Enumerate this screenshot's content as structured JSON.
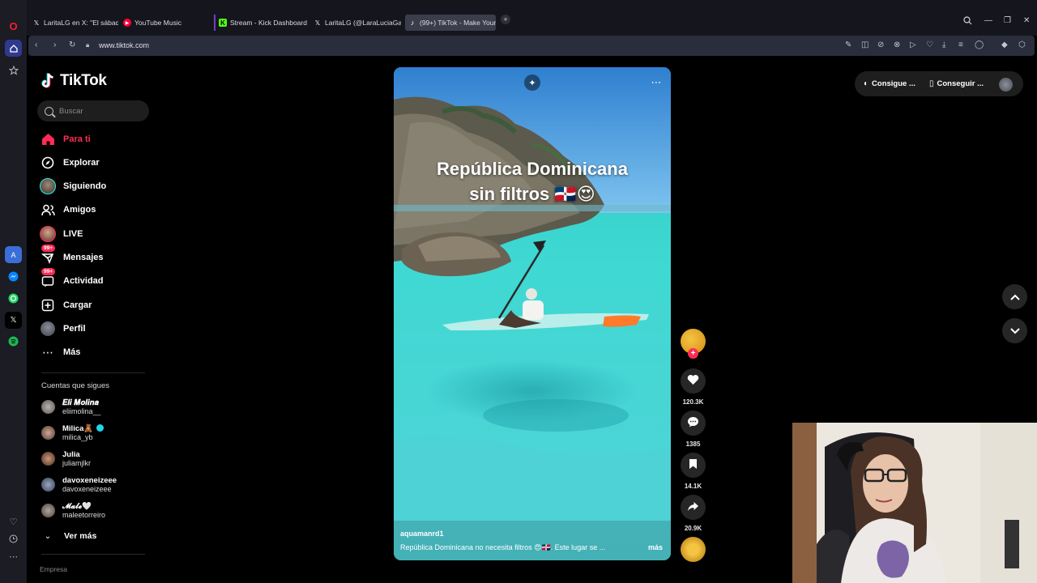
{
  "browser": {
    "tabs": [
      {
        "label": "LaritaLG en X: \"El sábado ·",
        "icon": "x-icon"
      },
      {
        "label": "YouTube Music",
        "icon": "youtube-music-icon"
      },
      {
        "label": "Stream - Kick Dashboard",
        "icon": "kick-icon"
      },
      {
        "label": "LaritaLG (@LaraLuciaGarc·",
        "icon": "x-icon"
      },
      {
        "label": "(99+) TikTok - Make Your ·",
        "icon": "tiktok-icon",
        "active": true
      }
    ],
    "url": "www.tiktok.com"
  },
  "sidebar": {
    "logo_text": "TikTok",
    "search_placeholder": "Buscar",
    "nav": [
      {
        "label": "Para ti",
        "icon": "home-icon",
        "active": true
      },
      {
        "label": "Explorar",
        "icon": "compass-icon"
      },
      {
        "label": "Siguiendo",
        "icon": "following-avatar-icon"
      },
      {
        "label": "Amigos",
        "icon": "friends-icon"
      },
      {
        "label": "LIVE",
        "icon": "live-avatar-icon"
      },
      {
        "label": "Mensajes",
        "icon": "messages-icon",
        "badge": "99+"
      },
      {
        "label": "Actividad",
        "icon": "activity-icon",
        "badge": "99+"
      },
      {
        "label": "Cargar",
        "icon": "upload-icon"
      },
      {
        "label": "Perfil",
        "icon": "profile-avatar-icon"
      },
      {
        "label": "Más",
        "icon": "more-icon"
      }
    ],
    "following_title": "Cuentas que sigues",
    "following": [
      {
        "display": "𝑬𝒍𝒊 𝑴𝒐𝒍𝒊𝒏𝒂",
        "handle": "eliimolina__"
      },
      {
        "display": "Milica🧸",
        "handle": "milica_yb",
        "verified": true
      },
      {
        "display": "Julia",
        "handle": "juliamjlkr"
      },
      {
        "display": "davoxeneizeee",
        "handle": "davoxeneizeee"
      },
      {
        "display": "𝓜𝓪𝓵𝓮🤍",
        "handle": "maleetorreiro"
      }
    ],
    "see_more": "Ver más",
    "footer_cut": "Empresa"
  },
  "video": {
    "caption_line1": "República Dominicana",
    "caption_line2": "sin filtros 🇩🇴😍",
    "author": "aquamanrd1",
    "description": "República Dominicana no necesita filtros 😍🇩🇴. Este lugar se ...",
    "more": "más"
  },
  "actions": {
    "likes": "120.3K",
    "comments": "1385",
    "saves": "14.1K",
    "shares": "20.9K"
  },
  "top_right": {
    "get_coins": "Consigue ...",
    "get_app": "Conseguir ..."
  },
  "colors": {
    "accent": "#fe2c55",
    "sidebar_bg": "#000000",
    "browser_bg": "#15161d"
  }
}
